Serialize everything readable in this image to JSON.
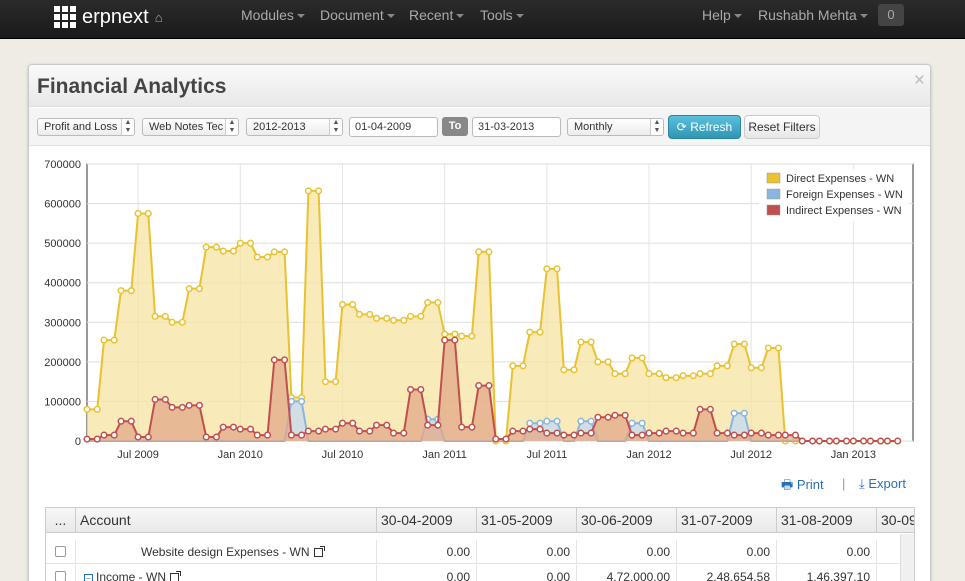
{
  "nav": {
    "brand": "erpnext",
    "menus": [
      "Modules",
      "Document",
      "Recent",
      "Tools"
    ],
    "help": "Help",
    "user": "Rushabh Mehta",
    "notifications": "0"
  },
  "page": {
    "title": "Financial Analytics",
    "close": "×"
  },
  "filters": {
    "report_type": "Profit and Loss",
    "company": "Web Notes Tec",
    "fiscal_year": "2012-2013",
    "from_date": "01-04-2009",
    "to_label": "To",
    "to_date": "31-03-2013",
    "period": "Monthly",
    "refresh_label": "Refresh",
    "reset_label": "Reset Filters"
  },
  "actions": {
    "print_label": "Print",
    "separator": "|",
    "export_label": "Export"
  },
  "chart_data": {
    "type": "area",
    "title": "",
    "ylim": [
      0,
      700000
    ],
    "y_ticks": [
      "700000",
      "600000",
      "500000",
      "400000",
      "300000",
      "200000",
      "100000",
      "0"
    ],
    "x_tick_labels": [
      "Jul 2009",
      "Jan 2010",
      "Jul 2010",
      "Jan 2011",
      "Jul 2011",
      "Jan 2012",
      "Jul 2012",
      "Jan 2013"
    ],
    "grid": true,
    "legend_position": "top-right",
    "x_start": "Apr 2009",
    "x_end": "Mar 2013",
    "series": [
      {
        "name": "Direct Expenses - WN",
        "color": "#e8c230",
        "fill": "#f5e3a1",
        "values": [
          80000,
          255000,
          380000,
          575000,
          315000,
          300000,
          385000,
          490000,
          480000,
          500000,
          465000,
          478000,
          110000,
          632000,
          150000,
          345000,
          320000,
          310000,
          305000,
          315000,
          350000,
          270000,
          265000,
          478000,
          0,
          190000,
          275000,
          435000,
          180000,
          250000,
          200000,
          170000,
          210000,
          170000,
          160000,
          165000,
          170000,
          190000,
          245000,
          185000,
          235000,
          0,
          0,
          0,
          0,
          0,
          0,
          0
        ]
      },
      {
        "name": "Foreign Expenses - WN",
        "color": "#8cb4e0",
        "fill": "#c4daf2",
        "values": [
          0,
          0,
          0,
          0,
          0,
          0,
          0,
          0,
          0,
          0,
          0,
          0,
          100000,
          0,
          0,
          0,
          0,
          0,
          0,
          0,
          55000,
          0,
          0,
          0,
          0,
          0,
          45000,
          50000,
          0,
          50000,
          0,
          0,
          45000,
          0,
          0,
          0,
          0,
          0,
          70000,
          0,
          0,
          0,
          0,
          0,
          0,
          0,
          0,
          0
        ]
      },
      {
        "name": "Indirect Expenses - WN",
        "color": "#c0504d",
        "fill": "#e3a88a",
        "values": [
          5000,
          15000,
          50000,
          10000,
          105000,
          85000,
          90000,
          10000,
          35000,
          30000,
          15000,
          205000,
          15000,
          25000,
          30000,
          45000,
          25000,
          40000,
          20000,
          130000,
          40000,
          255000,
          35000,
          140000,
          5000,
          25000,
          30000,
          20000,
          15000,
          20000,
          60000,
          65000,
          15000,
          20000,
          25000,
          20000,
          80000,
          20000,
          15000,
          20000,
          15000,
          15000,
          0,
          0,
          0,
          0,
          0,
          0
        ]
      }
    ]
  },
  "grid": {
    "headers": [
      "...",
      "Account",
      "30-04-2009",
      "31-05-2009",
      "30-06-2009",
      "31-07-2009",
      "31-08-2009",
      "30-09"
    ],
    "rows": [
      {
        "account": "Website design Expenses - WN",
        "values": [
          "0.00",
          "0.00",
          "0.00",
          "0.00",
          "0.00"
        ]
      },
      {
        "account": "Income - WN",
        "toggle": "−",
        "values": [
          "0.00",
          "0.00",
          "4,72,000.00",
          "2,48,654.58",
          "1,46,397.10"
        ]
      }
    ]
  }
}
